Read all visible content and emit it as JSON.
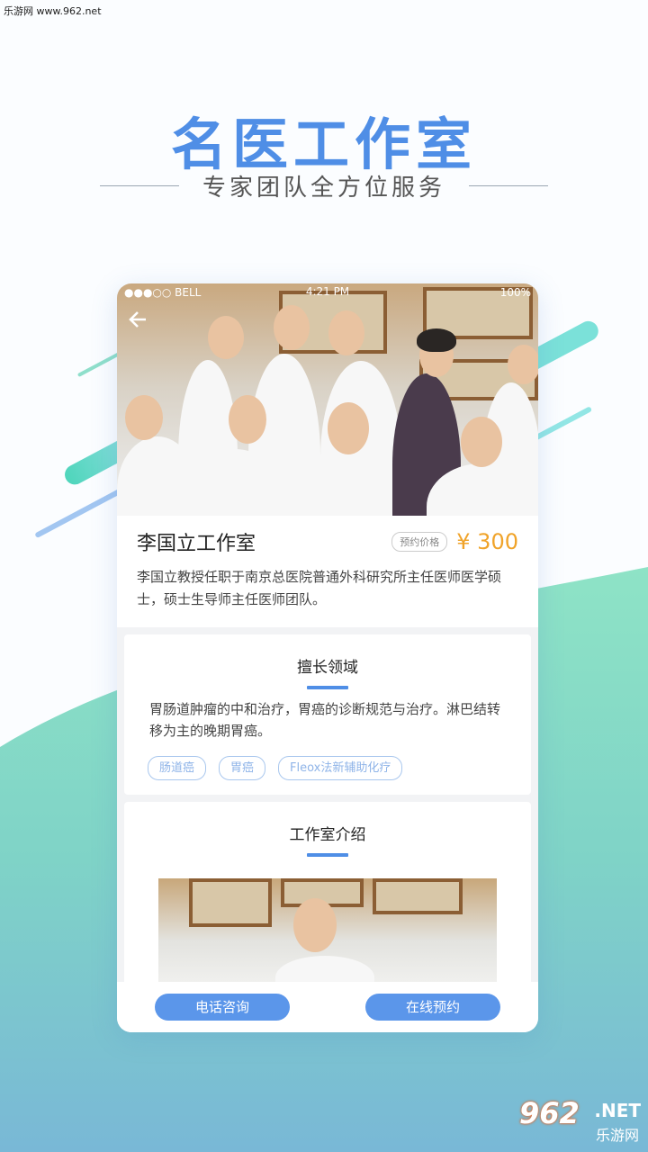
{
  "watermark": "乐游网 www.962.net",
  "hero": {
    "title": "名医工作室",
    "subtitle": "专家团队全方位服务"
  },
  "status_bar": {
    "carrier": "●●●○○ BELL",
    "time": "4:21 PM",
    "battery": "100%"
  },
  "studio": {
    "name": "李国立工作室",
    "price_label": "预约价格",
    "price": "¥ 300",
    "description": "李国立教授任职于南京总医院普通外科研究所主任医师医学硕士，硕士生导师主任医师团队。"
  },
  "specialty": {
    "title": "擅长领域",
    "text": "胃肠道肿瘤的中和治疗，胃癌的诊断规范与治疗。淋巴结转移为主的晚期胃癌。",
    "tags": [
      "肠道癌",
      "胃癌",
      "Fleox法新辅助化疗"
    ]
  },
  "intro": {
    "title": "工作室介绍"
  },
  "actions": {
    "phone": "电话咨询",
    "book": "在线预约"
  },
  "logo": {
    "num": "962",
    "net": ".NET",
    "cn": "乐游网"
  },
  "colors": {
    "accent": "#4f8ee6",
    "price": "#f0a329",
    "wave": "#7fd9c0"
  }
}
